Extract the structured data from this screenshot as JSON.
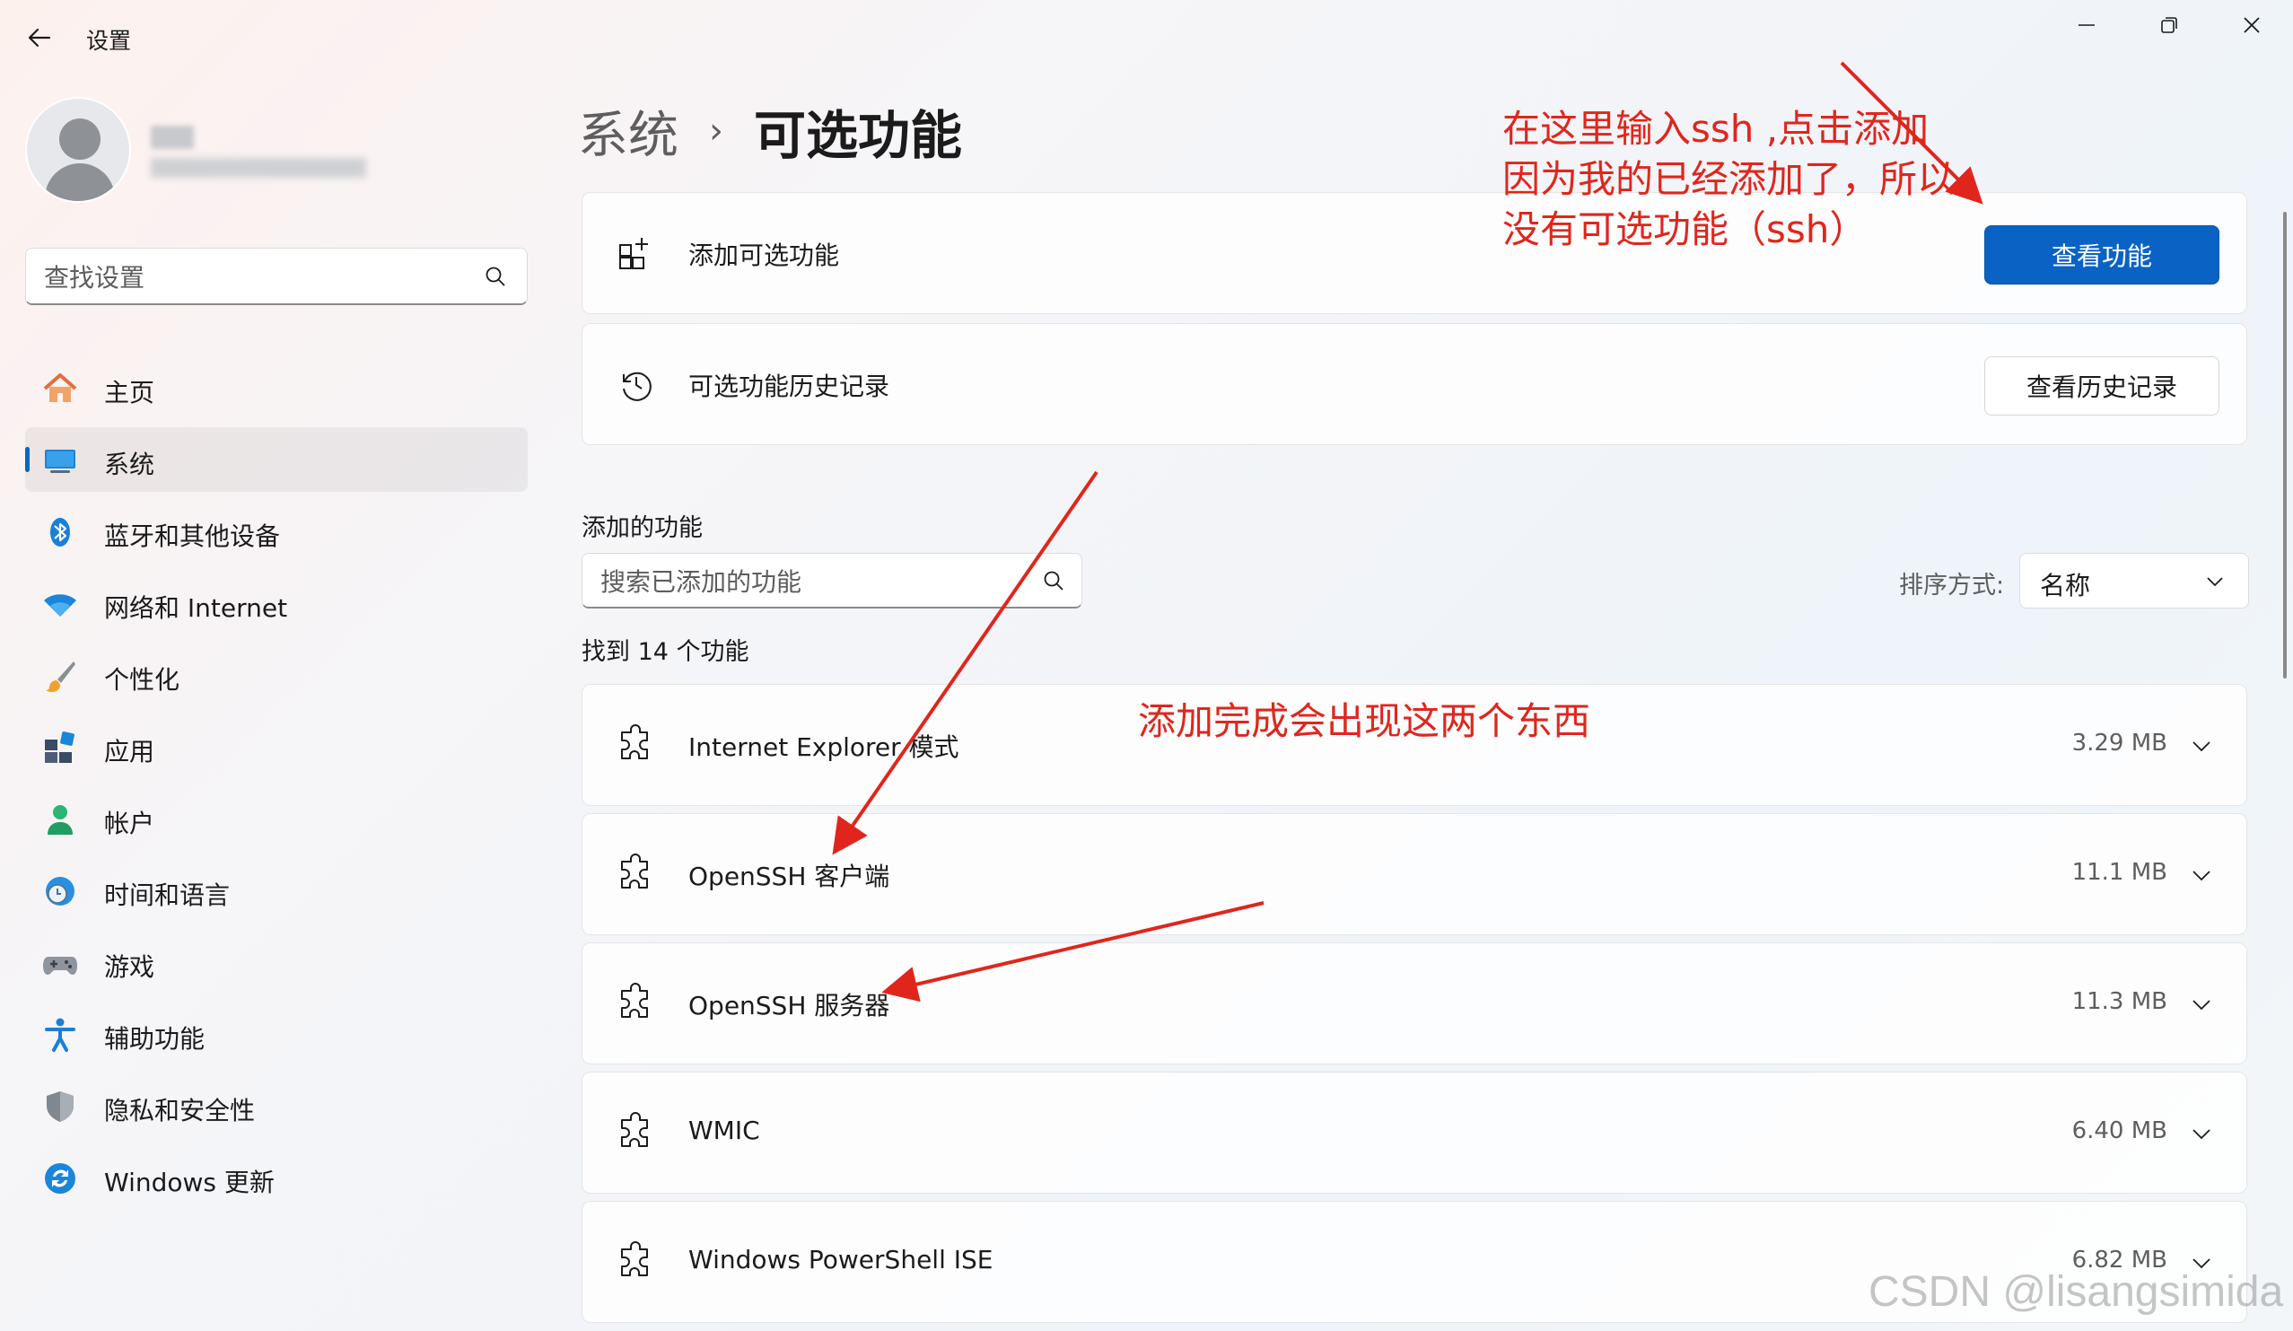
{
  "window": {
    "app_title": "设置",
    "back_icon": "arrow-left-icon",
    "minimize_icon": "minimize-icon",
    "maximize_icon": "restore-icon",
    "close_icon": "close-icon"
  },
  "sidebar": {
    "search": {
      "placeholder": "查找设置",
      "icon": "search-icon"
    },
    "items": [
      {
        "label": "主页",
        "icon": "home-icon",
        "active": false
      },
      {
        "label": "系统",
        "icon": "system-display-icon",
        "active": true
      },
      {
        "label": "蓝牙和其他设备",
        "icon": "bluetooth-icon",
        "active": false
      },
      {
        "label": "网络和 Internet",
        "icon": "wifi-icon",
        "active": false
      },
      {
        "label": "个性化",
        "icon": "paintbrush-icon",
        "active": false
      },
      {
        "label": "应用",
        "icon": "apps-icon",
        "active": false
      },
      {
        "label": "帐户",
        "icon": "account-icon",
        "active": false
      },
      {
        "label": "时间和语言",
        "icon": "time-language-icon",
        "active": false
      },
      {
        "label": "游戏",
        "icon": "gamepad-icon",
        "active": false
      },
      {
        "label": "辅助功能",
        "icon": "accessibility-icon",
        "active": false
      },
      {
        "label": "隐私和安全性",
        "icon": "shield-icon",
        "active": false
      },
      {
        "label": "Windows 更新",
        "icon": "windows-update-icon",
        "active": false
      }
    ]
  },
  "header": {
    "breadcrumb_parent": "系统",
    "breadcrumb_separator": "›",
    "breadcrumb_current": "可选功能"
  },
  "cards": {
    "add_feature": {
      "label": "添加可选功能",
      "button": "查看功能",
      "icon": "add-grid-icon"
    },
    "history": {
      "label": "可选功能历史记录",
      "button": "查看历史记录",
      "icon": "history-icon"
    }
  },
  "added_features": {
    "section_title": "添加的功能",
    "search_placeholder": "搜索已添加的功能",
    "sort_label": "排序方式:",
    "sort_value": "名称",
    "count_text": "找到 14 个功能",
    "items": [
      {
        "name": "Internet Explorer 模式",
        "size": "3.29 MB",
        "icon": "puzzle-icon"
      },
      {
        "name": "OpenSSH 客户端",
        "size": "11.1 MB",
        "icon": "puzzle-icon"
      },
      {
        "name": "OpenSSH 服务器",
        "size": "11.3 MB",
        "icon": "puzzle-icon"
      },
      {
        "name": "WMIC",
        "size": "6.40 MB",
        "icon": "puzzle-icon"
      },
      {
        "name": "Windows PowerShell ISE",
        "size": "6.82 MB",
        "icon": "puzzle-icon"
      }
    ]
  },
  "annotations": {
    "top_note_lines": [
      "在这里输入ssh ,点击添加",
      "因为我的已经添加了，所以",
      "没有可选功能（ssh）"
    ],
    "middle_note": "添加完成会出现这两个东西",
    "color": "#e0261c"
  },
  "watermark": "CSDN @lisangsimida",
  "colors": {
    "accent": "#0a63c4",
    "annotation": "#e0261c"
  }
}
